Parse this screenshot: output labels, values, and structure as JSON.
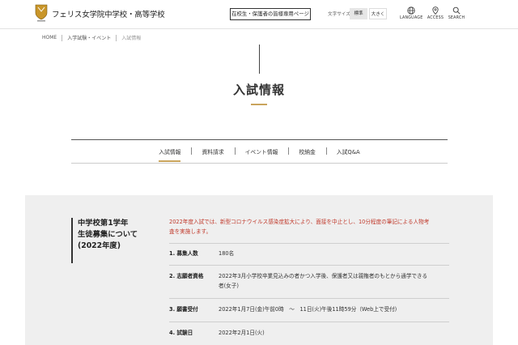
{
  "header": {
    "school_name": "フェリス女学院中学校・高等学校",
    "parents_link": "在校生・保護者の皆様専用ページ",
    "font_size_label": "文字サイズ",
    "font_size_standard": "標準",
    "font_size_large": "大きく",
    "language_label": "LANGUAGE",
    "access_label": "ACCESS",
    "search_label": "SEARCH"
  },
  "breadcrumb": {
    "home": "HOME",
    "section": "入学試験・イベント",
    "current": "入試情報"
  },
  "page": {
    "title": "入試情報"
  },
  "tabs": [
    {
      "label": "入試情報",
      "active": true
    },
    {
      "label": "資料請求"
    },
    {
      "label": "イベント情報"
    },
    {
      "label": "校納金"
    },
    {
      "label": "入試Q&A"
    }
  ],
  "content": {
    "heading_line1": "中学校第1学年",
    "heading_line2": "生徒募集について",
    "heading_line3": "(2022年度)",
    "notice_line1": "2022年度入試では、新型コロナウイルス感染症拡大により、面接を中止とし、10分程度の筆記による人物考",
    "notice_line2": "査を実施します。",
    "rows": [
      {
        "label": "1. 募集人数",
        "value_line1": "180名",
        "value_line2": ""
      },
      {
        "label": "2. 志願者資格",
        "value_line1": "2022年3月小学校卒業見込みの者かつ入学後、保護者又は親権者のもとから通学できる",
        "value_line2": "者(女子)"
      },
      {
        "label": "3. 願書受付",
        "value_line1": "2022年1月7日(金)午前0時　〜　11日(火)午後11時59分（Web上で受付)",
        "value_line2": ""
      },
      {
        "label": "4. 試験日",
        "value_line1": "2022年2月1日(火)",
        "value_line2": ""
      }
    ]
  },
  "colors": {
    "accent_gold": "#c9a45c",
    "notice_red": "#c0392b",
    "panel_bg": "#efefef"
  }
}
